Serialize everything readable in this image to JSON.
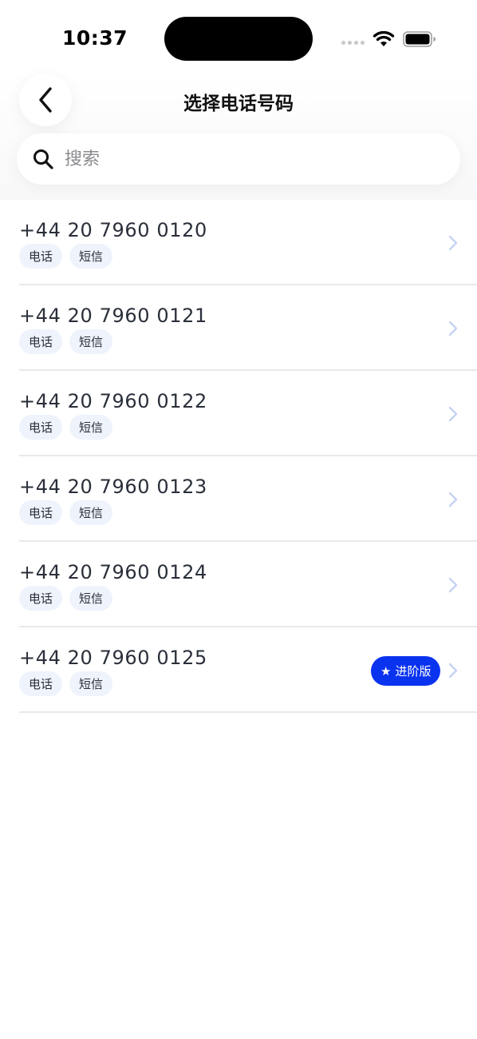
{
  "status_bar": {
    "time": "10:37"
  },
  "header": {
    "title": "选择电话号码"
  },
  "search": {
    "placeholder": "搜索",
    "value": ""
  },
  "numbers": [
    {
      "number": "+44 20 7960 0120",
      "tags": [
        "电话",
        "短信"
      ],
      "badge": null
    },
    {
      "number": "+44 20 7960 0121",
      "tags": [
        "电话",
        "短信"
      ],
      "badge": null
    },
    {
      "number": "+44 20 7960 0122",
      "tags": [
        "电话",
        "短信"
      ],
      "badge": null
    },
    {
      "number": "+44 20 7960 0123",
      "tags": [
        "电话",
        "短信"
      ],
      "badge": null
    },
    {
      "number": "+44 20 7960 0124",
      "tags": [
        "电话",
        "短信"
      ],
      "badge": null
    },
    {
      "number": "+44 20 7960 0125",
      "tags": [
        "电话",
        "短信"
      ],
      "badge": {
        "icon": "star-icon",
        "label": "进阶版"
      }
    }
  ],
  "colors": {
    "accent": "#0a33f0",
    "tag_bg": "#eef3fc",
    "chevron": "#c5d3f2"
  }
}
